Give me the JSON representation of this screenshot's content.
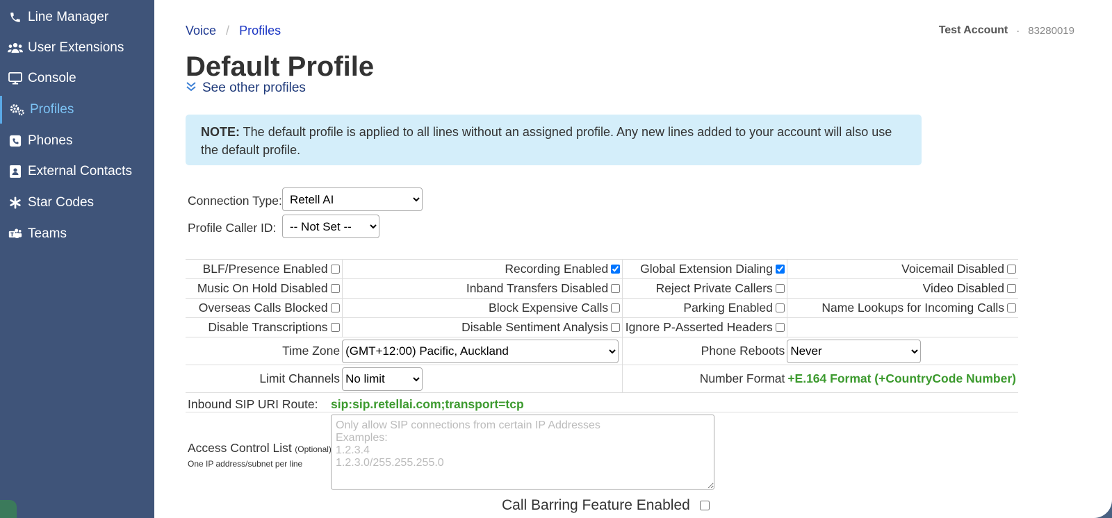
{
  "sidebar": {
    "items": [
      {
        "label": "Line Manager",
        "icon": "phone-icon"
      },
      {
        "label": "User Extensions",
        "icon": "users-icon"
      },
      {
        "label": "Console",
        "icon": "monitor-icon"
      },
      {
        "label": "Profiles",
        "icon": "gears-icon",
        "active": true
      },
      {
        "label": "Phones",
        "icon": "phone-square-icon"
      },
      {
        "label": "External Contacts",
        "icon": "address-book-icon"
      },
      {
        "label": "Star Codes",
        "icon": "asterisk-icon"
      },
      {
        "label": "Teams",
        "icon": "teams-icon"
      }
    ]
  },
  "breadcrumb": {
    "root": "Voice",
    "separator": "/",
    "current": "Profiles"
  },
  "account": {
    "name": "Test Account",
    "separator": "·",
    "number": "83280019"
  },
  "page": {
    "title": "Default Profile",
    "see_other": "See other profiles",
    "note_label": "NOTE:",
    "note_text": " The default profile is applied to all lines without an assigned profile. Any new lines added to your account will also use the default profile."
  },
  "form": {
    "connection_type_label": "Connection Type:",
    "connection_type_value": "Retell AI",
    "caller_id_label": "Profile Caller ID:",
    "caller_id_value": "-- Not Set --",
    "options": [
      [
        {
          "label": "BLF/Presence Enabled",
          "checked": false
        },
        {
          "label": "Recording Enabled",
          "checked": true
        },
        {
          "label": "Global Extension Dialing",
          "checked": true
        },
        {
          "label": "Voicemail Disabled",
          "checked": false
        }
      ],
      [
        {
          "label": "Music On Hold Disabled",
          "checked": false
        },
        {
          "label": "Inband Transfers Disabled",
          "checked": false
        },
        {
          "label": "Reject Private Callers",
          "checked": false
        },
        {
          "label": "Video Disabled",
          "checked": false
        }
      ],
      [
        {
          "label": "Overseas Calls Blocked",
          "checked": false
        },
        {
          "label": "Block Expensive Calls",
          "checked": false
        },
        {
          "label": "Parking Enabled",
          "checked": false
        },
        {
          "label": "Name Lookups for Incoming Calls",
          "checked": false
        }
      ],
      [
        {
          "label": "Disable Transcriptions",
          "checked": false
        },
        {
          "label": "Disable Sentiment Analysis",
          "checked": false
        },
        {
          "label": "Ignore P-Asserted Headers",
          "checked": false
        }
      ]
    ],
    "time_zone_label": "Time Zone",
    "time_zone_value": "(GMT+12:00) Pacific, Auckland",
    "phone_reboots_label": "Phone Reboots",
    "phone_reboots_value": "Never",
    "limit_channels_label": "Limit Channels",
    "limit_channels_value": "No limit",
    "number_format_label": "Number Format",
    "number_format_value": "+E.164 Format (+CountryCode Number)",
    "sip_route_label": "Inbound SIP URI Route:",
    "sip_route_value": "sip:sip.retellai.com;transport=tcp",
    "acl_label": "Access Control List",
    "acl_optional": "(Optional)",
    "acl_hint": "One IP address/subnet per line",
    "acl_placeholder": "Only allow SIP connections from certain IP Addresses\nExamples:\n1.2.3.4\n1.2.3.0/255.255.255.0",
    "call_barring_label": "Call Barring Feature Enabled",
    "call_barring_checked": false
  },
  "colors": {
    "sidebar": "#3f5479",
    "active_nav": "#7cc3f5",
    "note_bg": "#d4eefa",
    "green_value": "#3c9a2e",
    "link": "#1f3a93"
  }
}
